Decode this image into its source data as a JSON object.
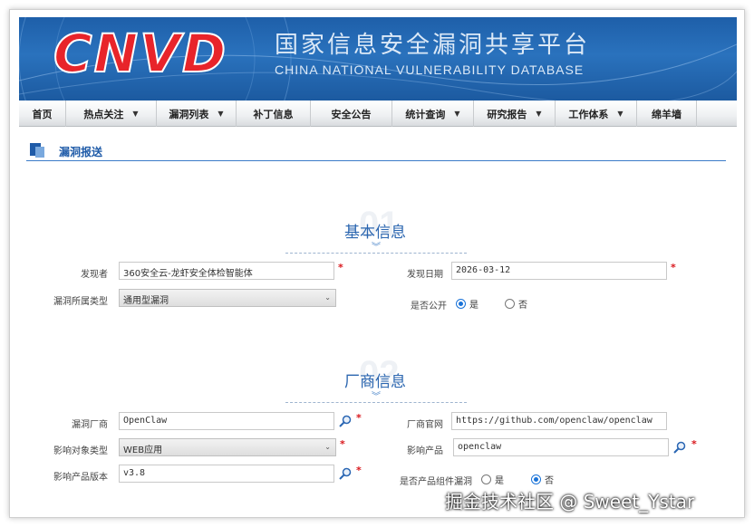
{
  "banner": {
    "logo": "CNVD",
    "title_cn": "国家信息安全漏洞共享平台",
    "title_en": "CHINA NATIONAL VULNERABILITY DATABASE"
  },
  "nav": {
    "items": [
      {
        "label": "首页",
        "dropdown": false
      },
      {
        "label": "热点关注",
        "dropdown": true
      },
      {
        "label": "漏洞列表",
        "dropdown": true
      },
      {
        "label": "补丁信息",
        "dropdown": false
      },
      {
        "label": "安全公告",
        "dropdown": false
      },
      {
        "label": "统计查询",
        "dropdown": true
      },
      {
        "label": "研究报告",
        "dropdown": true
      },
      {
        "label": "工作体系",
        "dropdown": true
      },
      {
        "label": "绵羊墙",
        "dropdown": false
      }
    ]
  },
  "section": {
    "title": "漏洞报送"
  },
  "basic": {
    "number": "01",
    "title": "基本信息",
    "discoverer_label": "发现者",
    "discoverer_value": "360安全云-龙虾安全体检智能体",
    "date_label": "发现日期",
    "date_value": "2026-03-12",
    "type_label": "漏洞所属类型",
    "type_value": "通用型漏洞",
    "public_label": "是否公开",
    "yes": "是",
    "no": "否"
  },
  "vendor": {
    "number": "02",
    "title": "厂商信息",
    "vendor_label": "漏洞厂商",
    "vendor_value": "OpenClaw",
    "site_label": "厂商官网",
    "site_value": "https://github.com/openclaw/openclaw",
    "object_label": "影响对象类型",
    "object_value": "WEB应用",
    "product_label": "影响产品",
    "product_value": "openclaw",
    "version_label": "影响产品版本",
    "version_value": "v3.8",
    "component_label": "是否产品组件漏洞",
    "yes": "是",
    "no": "否"
  },
  "watermark": "掘金技术社区 @ Sweet_Ystar",
  "required_mark": "*"
}
